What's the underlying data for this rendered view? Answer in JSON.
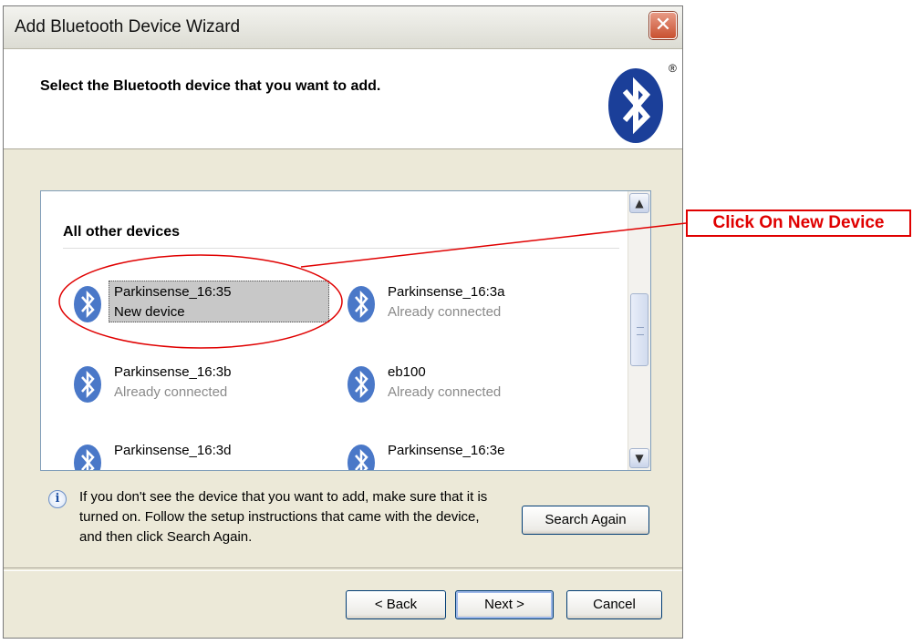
{
  "window": {
    "title": "Add Bluetooth Device Wizard",
    "close_glyph": "✕"
  },
  "header": {
    "instruction": "Select the Bluetooth device that you want to add.",
    "logo_icon": "bluetooth-logo-icon",
    "registered_mark": "®"
  },
  "device_list": {
    "group_title": "All other devices",
    "devices": [
      {
        "name": "Parkinsense_16:35",
        "status": "New device",
        "selected": true
      },
      {
        "name": "Parkinsense_16:3a",
        "status": "Already connected",
        "selected": false
      },
      {
        "name": "Parkinsense_16:3b",
        "status": "Already connected",
        "selected": false
      },
      {
        "name": "eb100",
        "status": "Already connected",
        "selected": false
      },
      {
        "name": "Parkinsense_16:3d",
        "status": "",
        "selected": false
      },
      {
        "name": "Parkinsense_16:3e",
        "status": "",
        "selected": false
      }
    ],
    "scroll_up_glyph": "▲",
    "scroll_down_glyph": "▼"
  },
  "info": {
    "icon": "info-icon",
    "text_lines": [
      "If you don't see the device that you want to add, make sure that it is",
      "turned on. Follow the setup instructions that came with the device,",
      "and then click Search Again."
    ]
  },
  "buttons": {
    "search_again": "Search Again",
    "back": "< Back",
    "next": "Next >",
    "cancel": "Cancel"
  },
  "annotation": {
    "callout_text": "Click  On New Device",
    "color": "#e00000"
  },
  "colors": {
    "bluetooth_blue": "#1b3f99",
    "device_icon_blue": "#4a78c8",
    "selection_gray": "#c8c8c8"
  }
}
